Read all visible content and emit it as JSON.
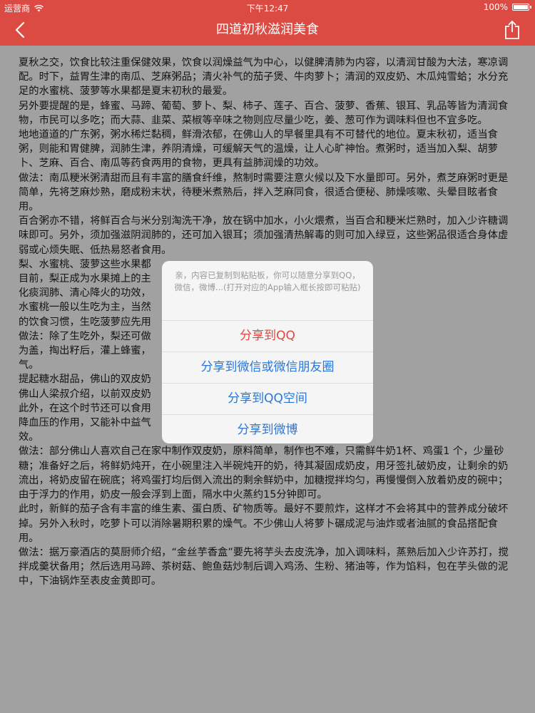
{
  "status": {
    "carrier": "运营商",
    "time": "下午12:47",
    "battery": "100%"
  },
  "nav": {
    "title": "四道初秋滋润美食"
  },
  "article": {
    "paragraphs": [
      "夏秋之交，饮食比较注重保健效果，饮食以润燥益气为中心，以健脾清肺为内容，以清润甘酸为大法，寒凉调配。时下，益胃生津的南瓜、芝麻粥品；清火补气的茄子煲、牛肉萝卜；清润的双皮奶、木瓜炖雪蛤；水分充足的水蜜桃、菠萝等水果都是夏末初秋的最爱。",
      "另外要提醒的是，蜂蜜、马蹄、葡萄、萝卜、梨、柿子、莲子、百合、菠萝、香蕉、银耳、乳品等皆为清润食物，市民可以多吃；而大蒜、韭菜、菜椒等辛味之物则应尽量少吃，姜、葱可作为调味料但也不宜多吃。",
      "地地道道的广东粥，粥水稀烂黏稠，鲜滑浓郁，在佛山人的早餐里具有不可替代的地位。夏末秋初，适当食粥，则能和胃健脾，润肺生津，养阴清燥，可缓解天气的温燥，让人心旷神怡。煮粥时，适当加入梨、胡萝卜、芝麻、百合、南瓜等药食两用的食物，更具有益肺润燥的功效。",
      "做法：南瓜粳米粥清甜而且有丰富的膳食纤维，熬制时需要注意火候以及下水量即可。另外，煮芝麻粥时更是简单，先将芝麻炒熟，磨成粉末状，待粳米煮熟后，拌入芝麻同食，很适合便秘、肺燥咳嗽、头晕目眩者食用。",
      "百合粥亦不错，将鲜百合与米分别淘洗干净，放在锅中加水，小火煨煮，当百合和粳米烂熟时，加入少许糖调味即可。另外，须加强滋阴润肺的，还可加入银耳；须加强清热解毒的则可加入绿豆，这些粥品很适合身体虚弱或心烦失眠、低热易怒者食用。",
      "梨、水蜜桃、菠萝这些水果都",
      "目前，梨正成为水果摊上的主",
      "化痰润肺、清心降火的功效，",
      "水蜜桃一般以生吃为主，当然",
      "的饮食习惯，生吃菠萝应先用",
      "做法：除了生吃外，梨还可做",
      "为盖，掏出籽后，灌上蜂蜜，",
      "气。",
      "提起糖水甜品，佛山的双皮奶",
      "佛山人梁叔介绍，以前双皮奶",
      "此外，在这个时节还可以食用",
      "降血压的作用，又能补中益气",
      "效。",
      "做法：部分佛山人喜欢自己在家中制作双皮奶，原料简单，制作也不难，只需鲜牛奶1杯、鸡蛋1 个，少量砂糖；准备好之后，将鲜奶炖开，在小碗里注入半碗炖开的奶，待其凝固成奶皮，用牙签扎破奶皮，让剩余的奶流出，将奶皮留在碗底；将鸡蛋打均后倒入流出的剩余鲜奶中，加糖搅拌均匀，再慢慢倒入放着奶皮的碗中；由于浮力的作用，奶皮一般会浮到上面，隔水中火蒸约15分钟即可。",
      "此时，新鲜的茄子含有丰富的维生素、蛋白质、矿物质等。最好不要煎炸，这样才不会将其中的营养成分破坏掉。另外入秋时，吃萝卜可以消除暑期积累的燥气。不少佛山人将萝卜碾成泥与油炸或者油腻的食品搭配食用。",
      "做法：据万豪酒店的莫厨师介绍，“金丝芋香盒”要先将芋头去皮洗净，加入调味料，蒸熟后加入少许苏打，搅拌成羹状备用；然后选用马蹄、茶树菇、鲍鱼菇炒制后调入鸡汤、生粉、猪油等，作为馅料，包在芋头做的泥中，下油锅炸至表皮金黄即可。"
    ]
  },
  "dialog": {
    "message": "亲，内容已复制到粘贴板，你可以随意分享到QQ，微信，微博...(打开对应的App输入框长按即可粘贴)",
    "options": [
      {
        "label": "分享到QQ"
      },
      {
        "label": "分享到微信或微信朋友圈"
      },
      {
        "label": "分享到QQ空间"
      },
      {
        "label": "分享到微博"
      }
    ]
  },
  "colors": {
    "brand_red": "#dc4b43",
    "link_blue": "#2b76d6",
    "primary_option": "#e0483e"
  },
  "icons": {
    "back": "chevron-left-icon",
    "share": "share-icon",
    "wifi": "wifi-icon",
    "battery": "battery-icon"
  }
}
